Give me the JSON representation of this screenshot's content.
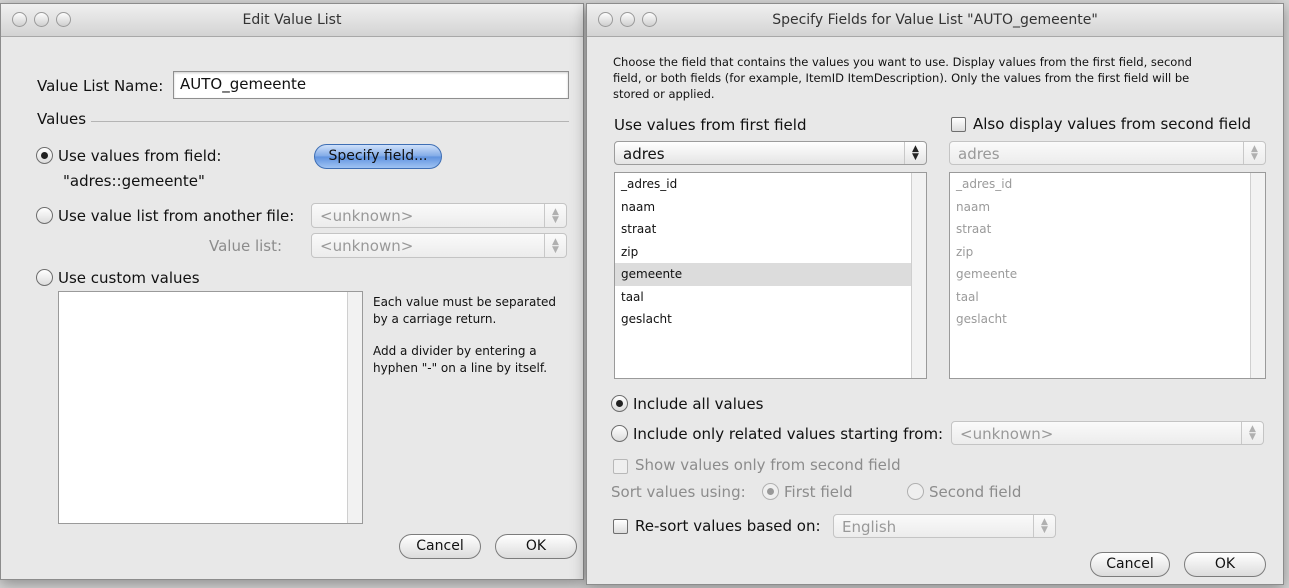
{
  "edit_dialog": {
    "title": "Edit Value List",
    "name_label": "Value List Name:",
    "name_value": "AUTO_gemeente",
    "values_heading": "Values",
    "option_field_label": "Use values from field:",
    "specify_field_button": "Specify field...",
    "field_ref": "\"adres::gemeente\"",
    "option_file_label": "Use value list from another file:",
    "file_popup": "<unknown>",
    "value_list_label": "Value list:",
    "value_list_popup": "<unknown>",
    "option_custom_label": "Use custom values",
    "help_line1": "Each value must be separated",
    "help_line2": "by a carriage return.",
    "help_line3": "Add a divider by entering a",
    "help_line4": "hyphen \"-\" on a line by itself.",
    "cancel_label": "Cancel",
    "ok_label": "OK"
  },
  "specify_dialog": {
    "title": "Specify Fields for Value List \"AUTO_gemeente\"",
    "desc_line1": "Choose the field that contains the values you want to use.  Display values from the first field, second",
    "desc_line2": "field, or both fields (for example, ItemID ItemDescription). Only the values from the first field will be",
    "desc_line3": "stored or applied.",
    "first_field_heading": "Use values from first field",
    "second_field_label": "Also display values from second field",
    "first_table_popup": "adres",
    "second_table_popup": "adres",
    "fields": [
      "_adres_id",
      "naam",
      "straat",
      "zip",
      "gemeente",
      "taal",
      "geslacht"
    ],
    "selected_field": "gemeente",
    "include_all_label": "Include all values",
    "include_related_label": "Include only related values starting from:",
    "related_popup": "<unknown>",
    "show_second_only_label": "Show values only from second field",
    "sort_label": "Sort values using:",
    "sort_first_label": "First field",
    "sort_second_label": "Second field",
    "resort_label": "Re-sort values based on:",
    "resort_popup": "English",
    "cancel_label": "Cancel",
    "ok_label": "OK"
  }
}
